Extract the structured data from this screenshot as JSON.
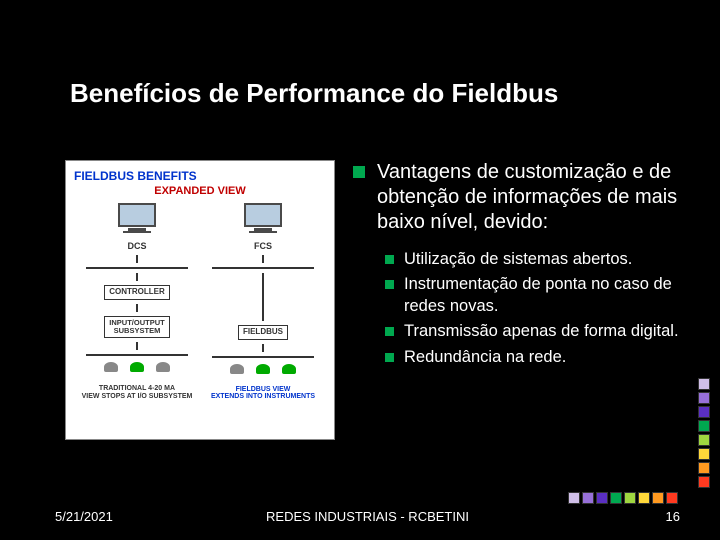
{
  "title": "Benefícios de Performance do Fieldbus",
  "figure": {
    "heading": "FIELDBUS BENEFITS",
    "sub": "EXPANDED VIEW",
    "left_label": "DCS",
    "right_label": "FCS",
    "controller": "CONTROLLER",
    "io": "INPUT/OUTPUT\nSUBSYSTEM",
    "fieldbus": "FIELDBUS",
    "caption_left": "TRADITIONAL 4-20 MA\nVIEW STOPS AT I/O SUBSYSTEM",
    "caption_right": "FIELDBUS VIEW\nEXTENDS INTO INSTRUMENTS"
  },
  "main_point": "Vantagens de customização e de obtenção de informações de mais baixo nível, devido:",
  "sub_points": [
    "Utilização de sistemas abertos.",
    "Instrumentação de ponta no caso de redes novas.",
    "Transmissão apenas de forma digital.",
    "Redundância na rede."
  ],
  "footer": {
    "date": "5/21/2021",
    "center": "REDES INDUSTRIAIS  - RCBETINI",
    "page": "16"
  },
  "palette_v": [
    "#d0bfe8",
    "#9770d8",
    "#5a2fc2",
    "#00a850",
    "#9fd640",
    "#ffd83a",
    "#ff9a20",
    "#ff3a20"
  ],
  "palette_h": [
    "#d0bfe8",
    "#9770d8",
    "#5a2fc2",
    "#00a850",
    "#9fd640",
    "#ffd83a",
    "#ff9a20",
    "#ff3a20"
  ]
}
